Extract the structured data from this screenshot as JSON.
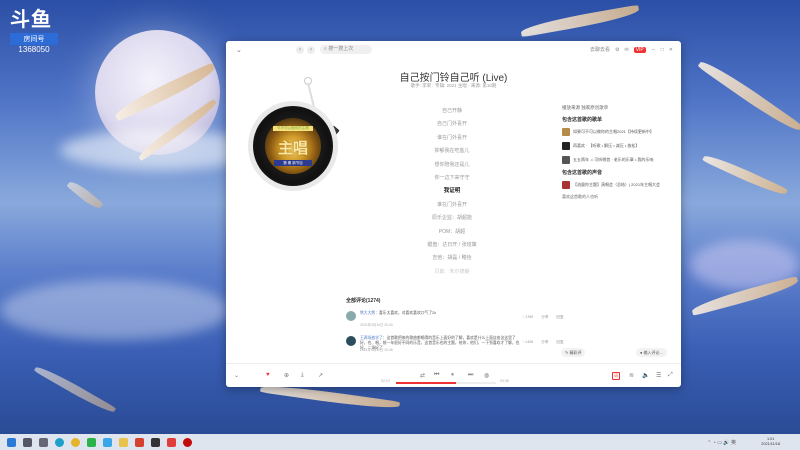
{
  "overlay": {
    "logo": "斗鱼",
    "room_label": "房间号",
    "room_id": "1368050"
  },
  "window": {
    "search_placeholder": "搜一搜上次",
    "topbar_right": [
      "去聊去看",
      "⚙",
      "✉",
      "VIP",
      "－",
      "□",
      "✕"
    ],
    "song_title": "自己按门铃自己听 (Live)",
    "song_subtitle": "歌手: 李荣 · 专辑: 2021 主唱 · 来源: 第10期"
  },
  "cover": {
    "top_text": "可不可以做你的主唱",
    "main_text": "主唱",
    "bottom_text": "第 期 新节目"
  },
  "lyrics": [
    {
      "text": "自己开静",
      "state": "normal"
    },
    {
      "text": "自己门外喜开",
      "state": "normal"
    },
    {
      "text": "谁在门外喜开",
      "state": "normal"
    },
    {
      "text": "抑郁我在吃盐儿",
      "state": "normal"
    },
    {
      "text": "想你陪我还是儿",
      "state": "normal"
    },
    {
      "text": "你一边下来守守",
      "state": "normal"
    },
    {
      "text": "我证明",
      "state": "active"
    },
    {
      "text": "谁在门外喜开",
      "state": "normal"
    },
    {
      "text": "原乐企监：胡超能",
      "state": "normal"
    },
    {
      "text": "POM：胡超",
      "state": "normal"
    },
    {
      "text": "键盘：达日开 / 张班策",
      "state": "normal"
    },
    {
      "text": "吉他：胡磊 / 略怡",
      "state": "normal"
    },
    {
      "text": "贝斯：朱尔德朗",
      "state": "faded"
    }
  ],
  "right_panel": {
    "header": "播放来源  独家原创歌单",
    "section1": "包含这首歌的歌单",
    "playlists": [
      "如果可不可以做你的主唱2021【持续更新中】",
      "再喜欢 · 【听歌 • 解压 • 减压 • 放松】",
      "五五两年 ♫ 可听哪首 · 老乐的乐章 • 我的乐响"
    ],
    "section2": "包含这首歌的声音",
    "sounds": [
      "【流量你主题】演唱会（总结）| 2021年主唱大会"
    ],
    "link": "喜欢这首歌的人也听"
  },
  "comments": {
    "title": "全部评论(1274)",
    "items": [
      {
        "user": "熊大大熊",
        "text": "：喜乐太喜欢，对喜欢喜欢口气了2k",
        "meta": "2021年4月10日 20:40",
        "likes": "1789",
        "share": "分享",
        "reply": "回复"
      },
      {
        "user": "王两场放学了",
        "text": "：这首歌把来的歌曲都唱得的音乐上面好的了解，喜欢是什么上面自由这这里了好，也、唱，前一年很好不同的乐音，这首音乐也的主题，给你，他们，一下到喜欢才了解，也好，二场好了",
        "meta": "2021年4月10日 20:46",
        "likes": "1408",
        "share": "分享",
        "reply": "回复"
      }
    ],
    "pill_left": "精彩评",
    "pill_right": "输入评论..."
  },
  "player": {
    "time_current": "02:10",
    "time_total": "03:38",
    "progress": 0.6,
    "lyric_btn": "词",
    "accent": "#e33b3b"
  },
  "taskbar": {
    "time": "1:01",
    "date": "2021/11/18"
  }
}
